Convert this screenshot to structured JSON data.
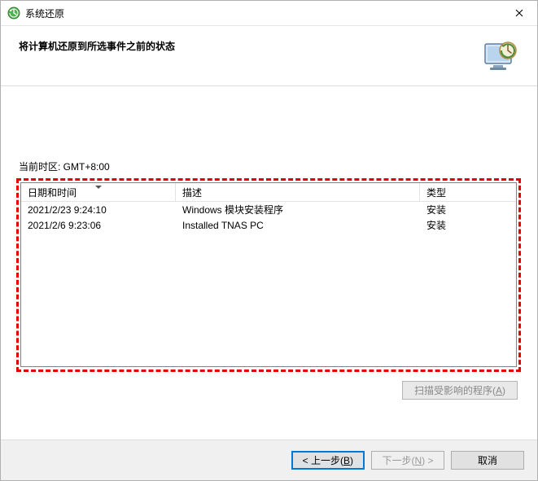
{
  "window": {
    "title": "系统还原"
  },
  "header": {
    "heading": "将计算机还原到所选事件之前的状态"
  },
  "timezone_label": "当前时区: GMT+8:00",
  "columns": {
    "date": "日期和时间",
    "desc": "描述",
    "type": "类型"
  },
  "rows": [
    {
      "date": "2021/2/23 9:24:10",
      "desc": "Windows 模块安装程序",
      "type": "安装"
    },
    {
      "date": "2021/2/6 9:23:06",
      "desc": "Installed TNAS PC",
      "type": "安装"
    }
  ],
  "buttons": {
    "scan_affected_prefix": "扫描受影响的程序(",
    "scan_affected_hotkey": "A",
    "scan_affected_suffix": ")",
    "back_prefix": "< 上一步(",
    "back_hotkey": "B",
    "back_suffix": ")",
    "next_prefix": "下一步(",
    "next_hotkey": "N",
    "next_suffix": ") >",
    "cancel": "取消"
  }
}
